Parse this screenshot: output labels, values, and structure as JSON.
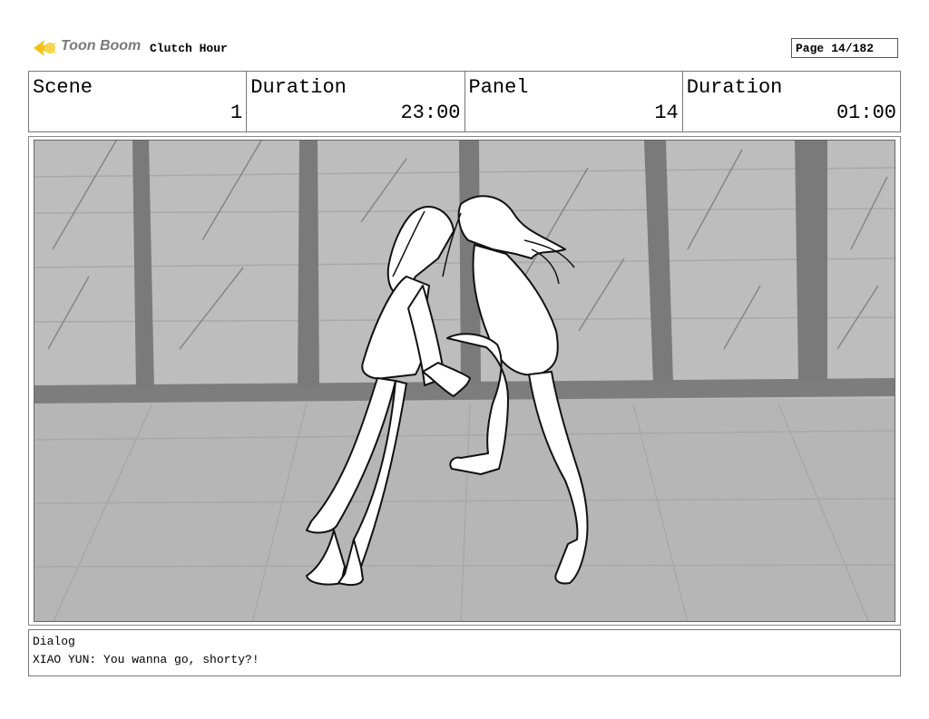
{
  "header": {
    "logo_text": "Toon Boom",
    "project_title": "Clutch Hour",
    "page_label": "Page",
    "page_value": "14/182"
  },
  "info": [
    {
      "label": "Scene",
      "value": "1"
    },
    {
      "label": "Duration",
      "value": "23:00"
    },
    {
      "label": "Panel",
      "value": "14"
    },
    {
      "label": "Duration",
      "value": "01:00"
    }
  ],
  "dialog": {
    "label": "Dialog",
    "text": "XIAO YUN: You wanna go, shorty?!"
  },
  "colors": {
    "logo_accent": "#f2c21b",
    "panel_background": "#bdbdbd",
    "tree_trunks": "#7a7a7a"
  }
}
